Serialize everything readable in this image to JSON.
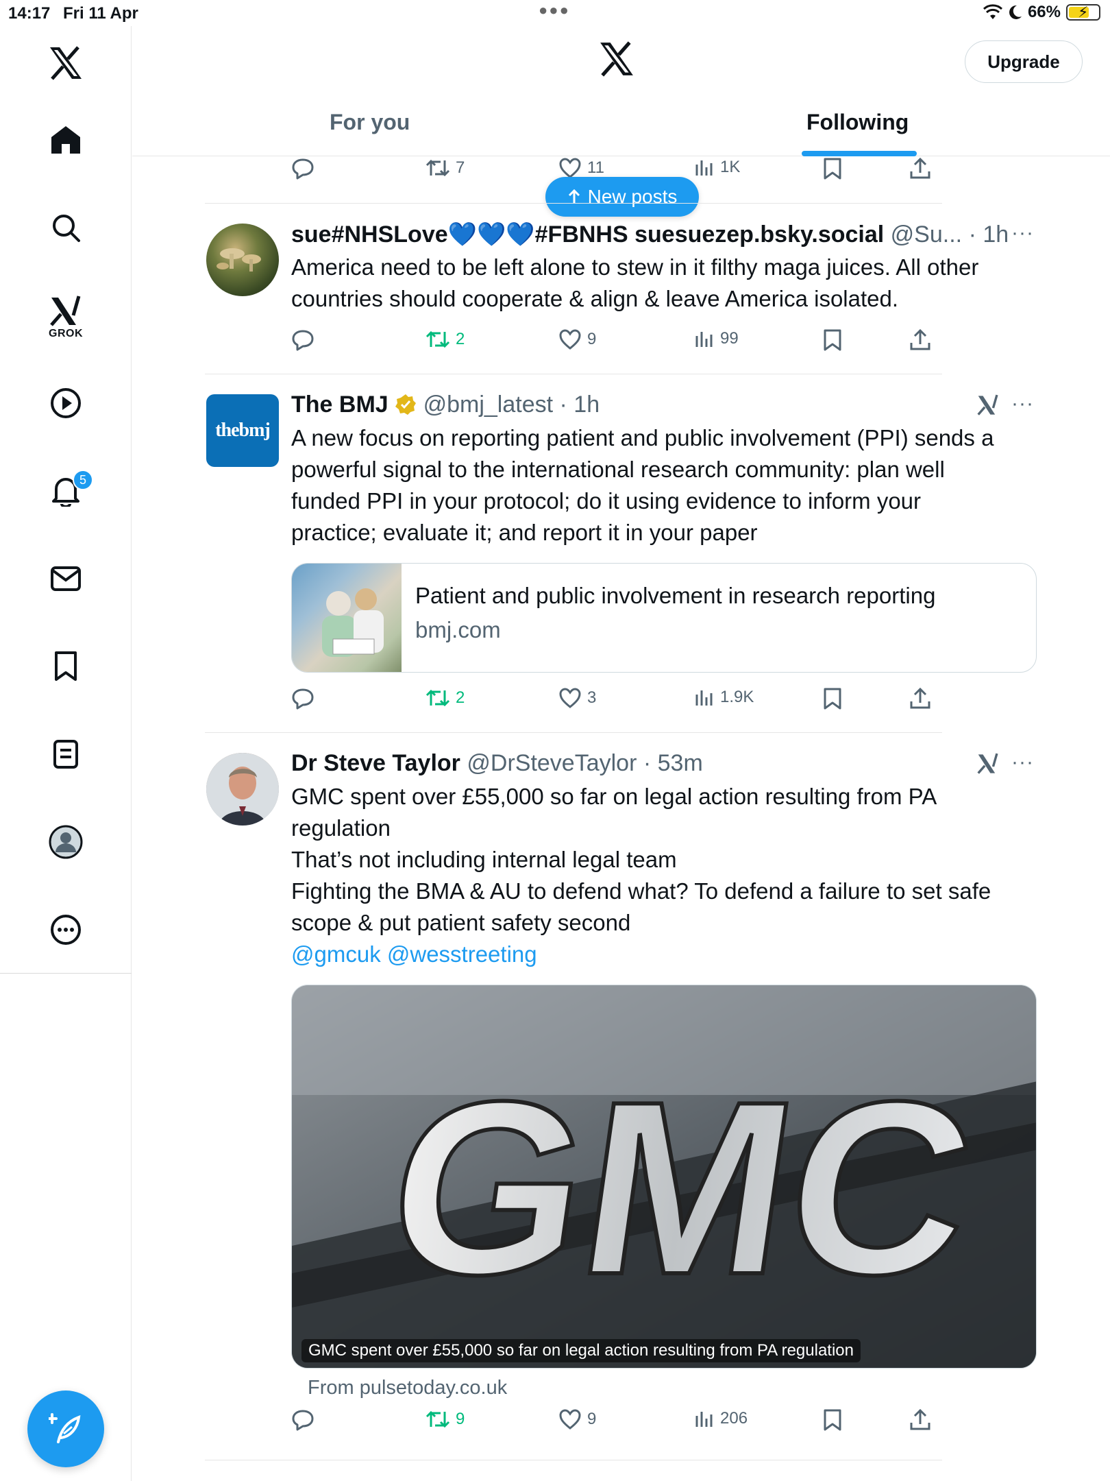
{
  "status_bar": {
    "time": "14:17",
    "date": "Fri 11 Apr",
    "battery": "66%",
    "battery_level": 0.66
  },
  "sidebar": {
    "items": [
      "x-logo",
      "home",
      "search",
      "grok",
      "videos",
      "notifications",
      "messages",
      "bookmarks",
      "lists",
      "profile",
      "more"
    ],
    "grok_label": "GROK",
    "notification_count": "5"
  },
  "header": {
    "upgrade_label": "Upgrade",
    "tabs": [
      {
        "label": "For you",
        "active": false
      },
      {
        "label": "Following",
        "active": true
      }
    ]
  },
  "new_posts_label": "New posts",
  "colors": {
    "accent": "#1d9bf0",
    "repost_active": "#00ba7c",
    "secondary_text": "#536471"
  },
  "tweets": [
    {
      "partial": true,
      "stats": {
        "reply": "",
        "repost": "7",
        "like": "11",
        "views": "1K"
      }
    },
    {
      "name": "sue#NHSLove💙💙💙#FBNHS suesuezep.bsky.social",
      "handle": "@Su...",
      "time": "1h",
      "body_lines": [
        "America need to be left alone to stew in it filthy  maga juices. All other",
        "countries should cooperate & align & leave America isolated."
      ],
      "stats": {
        "repost": "2",
        "like": "9",
        "views": "99"
      }
    },
    {
      "name": "The BMJ",
      "verified": true,
      "handle": "@bmj_latest",
      "time": "1h",
      "avatar_text": "thebmj",
      "body_lines": [
        "A new focus on reporting patient and public involvement (PPI) sends a",
        "powerful signal to the international research community: plan well",
        "funded PPI in your protocol; do it using evidence to inform your",
        "practice; evaluate it; and report it in your paper"
      ],
      "card": {
        "title": "Patient and public involvement in research reporting",
        "domain": "bmj.com"
      },
      "stats": {
        "repost": "2",
        "like": "3",
        "views": "1.9K"
      }
    },
    {
      "name": "Dr Steve Taylor",
      "handle": "@DrSteveTaylor",
      "time": "53m",
      "body_lines": [
        "GMC spent over £55,000 so far on legal action resulting from PA",
        "regulation",
        "That’s not including internal legal team",
        "Fighting the BMA & AU to defend what? To defend a failure to set safe",
        "scope & put patient safety second"
      ],
      "mentions": "@gmcuk @wesstreeting",
      "media": {
        "sign_text": "GMC",
        "caption": "GMC spent over £55,000 so far on legal action resulting from PA regulation",
        "source": "From pulsetoday.co.uk"
      },
      "stats": {
        "repost": "9",
        "like": "9",
        "views": "206"
      }
    }
  ]
}
